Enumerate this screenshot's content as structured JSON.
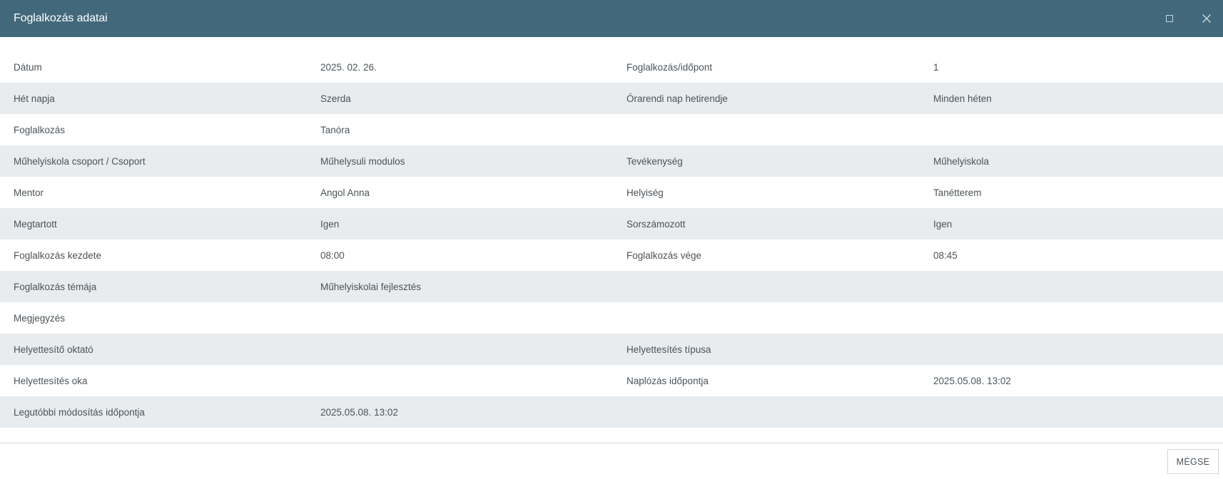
{
  "dialog": {
    "title": "Foglalkozás adatai",
    "maximize_icon": "maximize-icon",
    "close_icon": "close-icon"
  },
  "rows": [
    {
      "label1": "Dátum",
      "value1": "2025. 02. 26.",
      "label2": "Foglalkozás/időpont",
      "value2": "1"
    },
    {
      "label1": "Hét napja",
      "value1": "Szerda",
      "label2": "Órarendi nap hetirendje",
      "value2": "Minden héten"
    },
    {
      "label1": "Foglalkozás",
      "value1": "Tanóra",
      "label2": "",
      "value2": ""
    },
    {
      "label1": "Műhelyiskola csoport / Csoport",
      "value1": "Műhelysuli modulos",
      "label2": "Tevékenység",
      "value2": "Műhelyiskola"
    },
    {
      "label1": "Mentor",
      "value1": "Angol Anna",
      "label2": "Helyiség",
      "value2": "Tanétterem"
    },
    {
      "label1": "Megtartott",
      "value1": "Igen",
      "label2": "Sorszámozott",
      "value2": "Igen"
    },
    {
      "label1": "Foglalkozás kezdete",
      "value1": "08:00",
      "label2": "Foglalkozás vége",
      "value2": "08:45"
    },
    {
      "label1": "Foglalkozás témája",
      "value1": "Műhelyiskolai fejlesztés",
      "label2": "",
      "value2": ""
    },
    {
      "label1": "Megjegyzés",
      "value1": "",
      "label2": "",
      "value2": ""
    },
    {
      "label1": "Helyettesítő oktató",
      "value1": "",
      "label2": "Helyettesítés típusa",
      "value2": ""
    },
    {
      "label1": "Helyettesítés oka",
      "value1": "",
      "label2": "Naplózás időpontja",
      "value2": "2025.05.08. 13:02"
    },
    {
      "label1": "Legutóbbi módosítás időpontja",
      "value1": "2025.05.08. 13:02",
      "label2": "",
      "value2": ""
    }
  ],
  "footer": {
    "cancel_label": "MÉGSE"
  },
  "colors": {
    "titlebar": "#42697b",
    "alt_row": "#e8ecef",
    "text": "#4b5358"
  }
}
